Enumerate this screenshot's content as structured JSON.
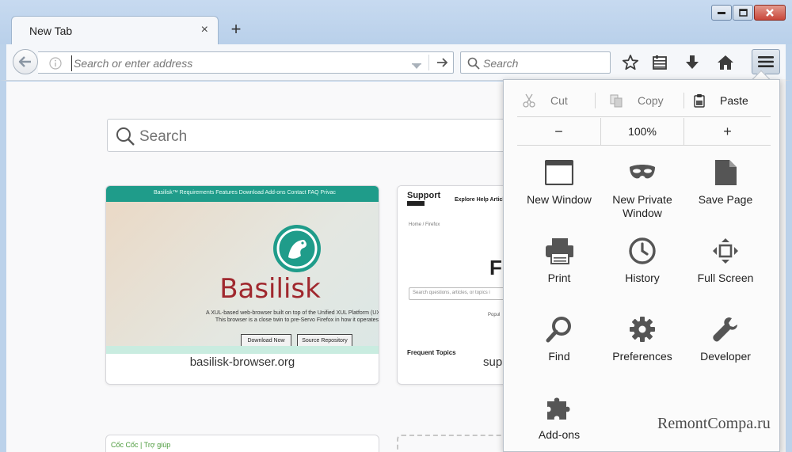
{
  "tab": {
    "title": "New Tab",
    "close": "×",
    "new_tab": "+"
  },
  "navbar": {
    "url_placeholder": "Search or enter address",
    "search_placeholder": "Search"
  },
  "content": {
    "search_text": "Search",
    "tiles": [
      {
        "caption": "basilisk-browser.org",
        "thumb": {
          "nav": "Basilisk™    Requirements    Features    Download    Add-ons    Contact    FAQ    Privac",
          "name": "Basilisk",
          "desc_line1": "A XUL-based web-browser built on top of the Unified XUL Platform (UX",
          "desc_line2": "This browser is a close twin to pre-Servo Firefox in how it operates.",
          "btn1": "Download Now",
          "btn2": "Source Repository"
        }
      },
      {
        "caption": "sup",
        "thumb": {
          "logo": "Support",
          "nav": "Explore Help Article",
          "crumb": "Home / Firefox",
          "heading": "Fi",
          "field": "Search questions, articles, or topics i",
          "popular": "Popul",
          "frequent": "Frequent Topics"
        }
      }
    ],
    "bottom_tile_text": "Cốc Cốc  |  Trợ giúp"
  },
  "menu": {
    "cut": "Cut",
    "copy": "Copy",
    "paste": "Paste",
    "zoom_out": "−",
    "zoom_level": "100%",
    "zoom_in": "+",
    "items": [
      {
        "label": "New Window",
        "icon": "new-window-icon"
      },
      {
        "label": "New Private\nWindow",
        "icon": "private-mask-icon"
      },
      {
        "label": "Save Page",
        "icon": "save-page-icon"
      },
      {
        "label": "Print",
        "icon": "printer-icon"
      },
      {
        "label": "History",
        "icon": "clock-icon"
      },
      {
        "label": "Full Screen",
        "icon": "fullscreen-icon"
      },
      {
        "label": "Find",
        "icon": "magnifier-icon"
      },
      {
        "label": "Preferences",
        "icon": "gear-icon"
      },
      {
        "label": "Developer",
        "icon": "wrench-icon"
      },
      {
        "label": "Add-ons",
        "icon": "puzzle-icon"
      }
    ]
  },
  "watermark": "RemontCompa.ru",
  "colors": {
    "accent_basilisk": "#1f9c8a",
    "basilisk_red": "#a0282e",
    "close_red": "#c9463a"
  }
}
